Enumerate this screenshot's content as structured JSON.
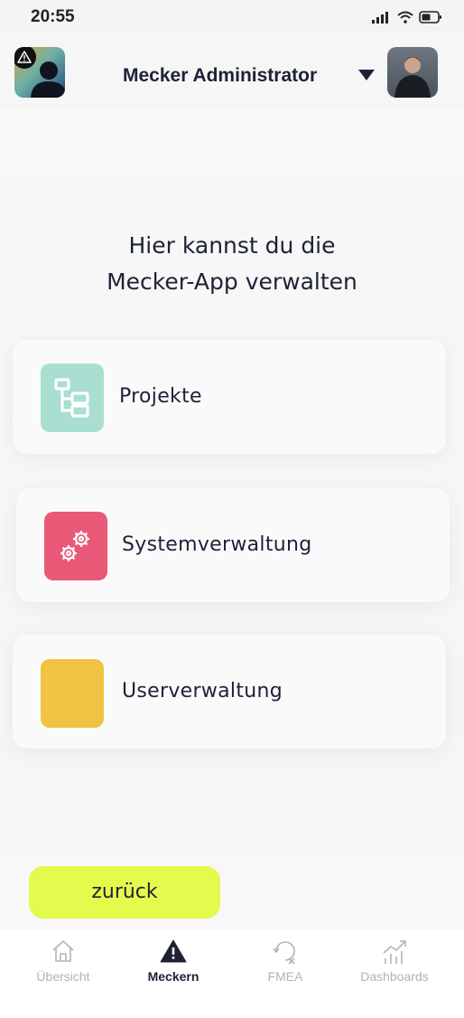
{
  "status_bar": {
    "time": "20:55"
  },
  "header": {
    "user_name": "Mecker Administrator"
  },
  "main": {
    "heading_line1": "Hier kannst du die",
    "heading_line2": "Mecker-App verwalten",
    "cards": [
      {
        "label": "Projekte",
        "icon": "project-structure-icon",
        "color": "#a8dfd1"
      },
      {
        "label": "Systemverwaltung",
        "icon": "gears-icon",
        "color": "#ea5a78"
      },
      {
        "label": "Userverwaltung",
        "icon": "none",
        "color": "#f0c343"
      }
    ]
  },
  "back_button": {
    "label": "zurück",
    "color": "#e4fa4c"
  },
  "tab_bar": {
    "tabs": [
      {
        "label": "Übersicht",
        "icon": "home-icon",
        "active": false
      },
      {
        "label": "Meckern",
        "icon": "warning-icon",
        "active": true
      },
      {
        "label": "FMEA",
        "icon": "refresh-x-icon",
        "active": false
      },
      {
        "label": "Dashboards",
        "icon": "chart-icon",
        "active": false
      }
    ]
  }
}
